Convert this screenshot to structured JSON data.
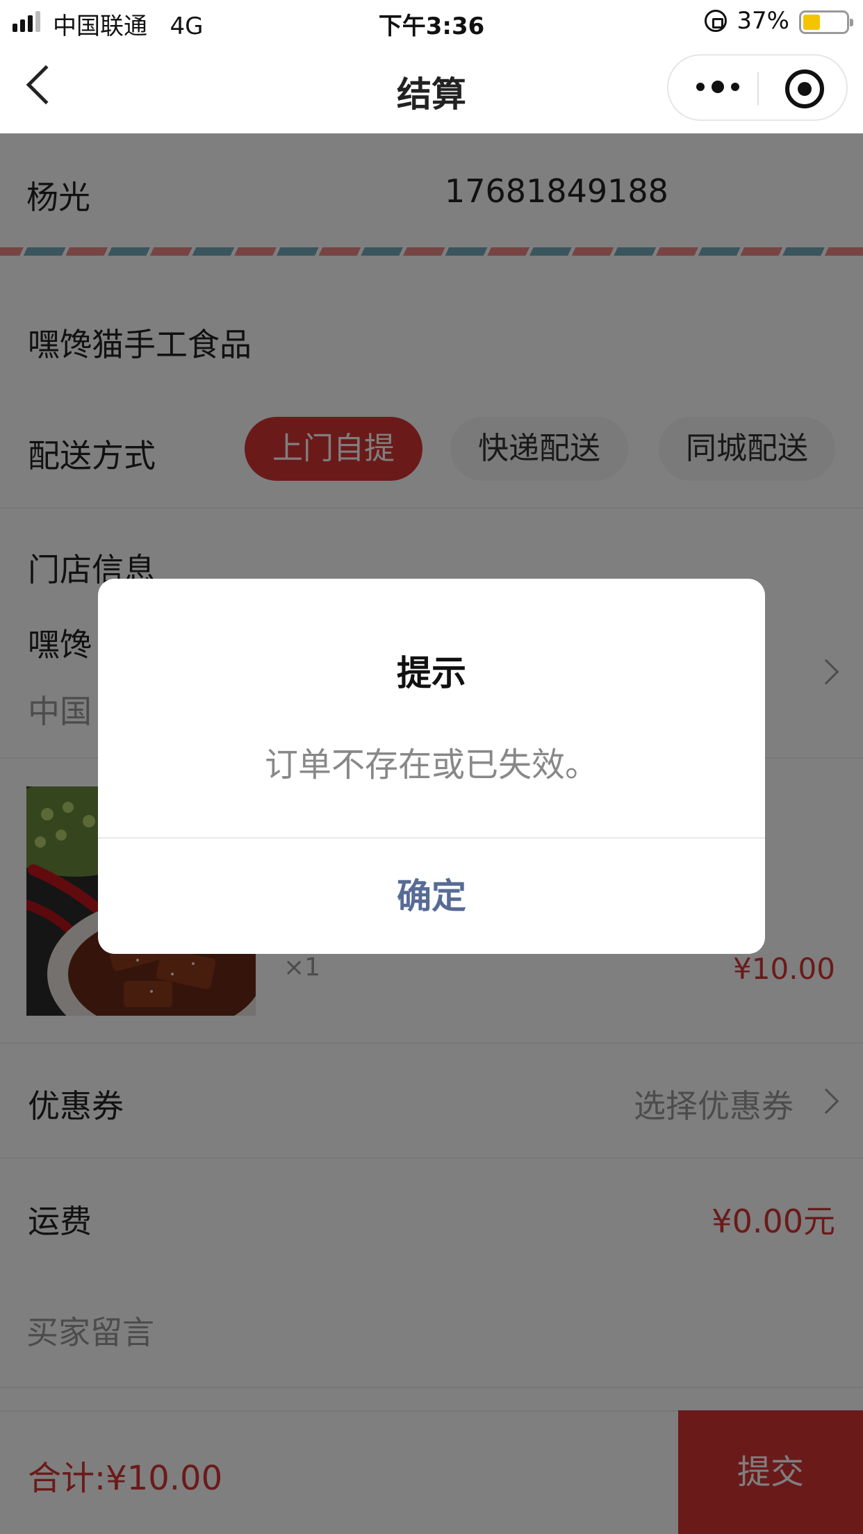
{
  "status_bar": {
    "carrier": "中国联通",
    "network": "4G",
    "time": "下午3:36",
    "battery": "37%",
    "battery_level": 0.37
  },
  "nav": {
    "title": "结算"
  },
  "address": {
    "name": "杨光",
    "phone": "17681849188"
  },
  "store_name": "嘿馋猫手工食品",
  "delivery": {
    "label": "配送方式",
    "options": [
      "上门自提",
      "快递配送",
      "同城配送"
    ],
    "selected": "上门自提"
  },
  "store_info": {
    "title": "门店信息",
    "name_partial": "嘿馋",
    "address_partial": "中国"
  },
  "product": {
    "qty": "×1",
    "price": "¥10.00"
  },
  "coupon": {
    "label": "优惠券",
    "value": "选择优惠券"
  },
  "shipping": {
    "label": "运费",
    "value": "¥0.00元"
  },
  "message": {
    "placeholder": "买家留言"
  },
  "footer": {
    "total": "合计:¥10.00",
    "submit": "提交"
  },
  "dialog": {
    "title": "提示",
    "message": "订单不存在或已失效。",
    "confirm": "确定"
  },
  "colors": {
    "accent": "#d73535",
    "dialog_button": "#576b95"
  }
}
